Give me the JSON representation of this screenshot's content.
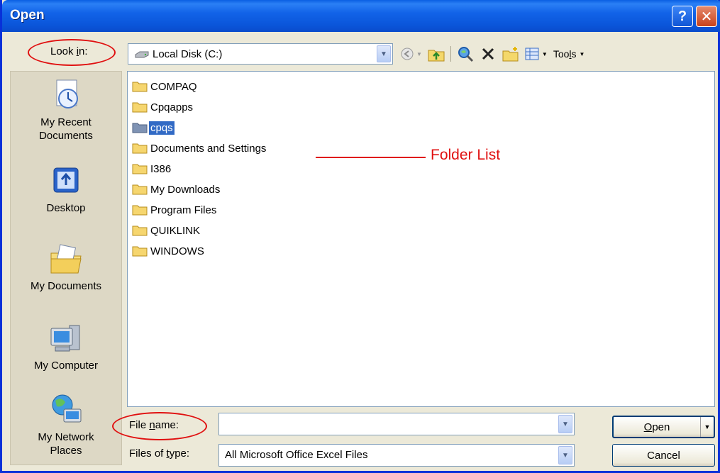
{
  "window": {
    "title": "Open",
    "help_glyph": "?",
    "close_glyph": "✕"
  },
  "lookin": {
    "label_pre": "Look ",
    "label_u": "i",
    "label_post": "n:",
    "value": "Local Disk (C:)"
  },
  "toolbar": {
    "tools_pre": "Too",
    "tools_u": "l",
    "tools_post": "s"
  },
  "places": [
    {
      "label": "My Recent Documents",
      "icon": "recent-documents-icon"
    },
    {
      "label": "Desktop",
      "icon": "desktop-icon"
    },
    {
      "label": "My Documents",
      "icon": "my-documents-icon"
    },
    {
      "label": "My Computer",
      "icon": "my-computer-icon"
    },
    {
      "label": "My Network Places",
      "icon": "network-places-icon"
    }
  ],
  "folders": [
    {
      "name": "COMPAQ",
      "selected": false
    },
    {
      "name": "Cpqapps",
      "selected": false
    },
    {
      "name": "cpqs",
      "selected": true
    },
    {
      "name": "Documents and Settings",
      "selected": false
    },
    {
      "name": "I386",
      "selected": false
    },
    {
      "name": "My Downloads",
      "selected": false
    },
    {
      "name": "Program Files",
      "selected": false
    },
    {
      "name": "QUIKLINK",
      "selected": false
    },
    {
      "name": "WINDOWS",
      "selected": false
    }
  ],
  "annotation": {
    "folder_list": "Folder List"
  },
  "filename": {
    "label_pre": "File ",
    "label_u": "n",
    "label_post": "ame:",
    "value": ""
  },
  "filetype": {
    "label_pre": "Files of ",
    "label_u": "t",
    "label_post": "ype:",
    "value": "All Microsoft Office Excel Files"
  },
  "buttons": {
    "open_u": "O",
    "open_post": "pen",
    "cancel": "Cancel"
  },
  "colors": {
    "selection": "#316ac5",
    "annotation_red": "#e01010",
    "title_blue": "#0a55d9"
  }
}
